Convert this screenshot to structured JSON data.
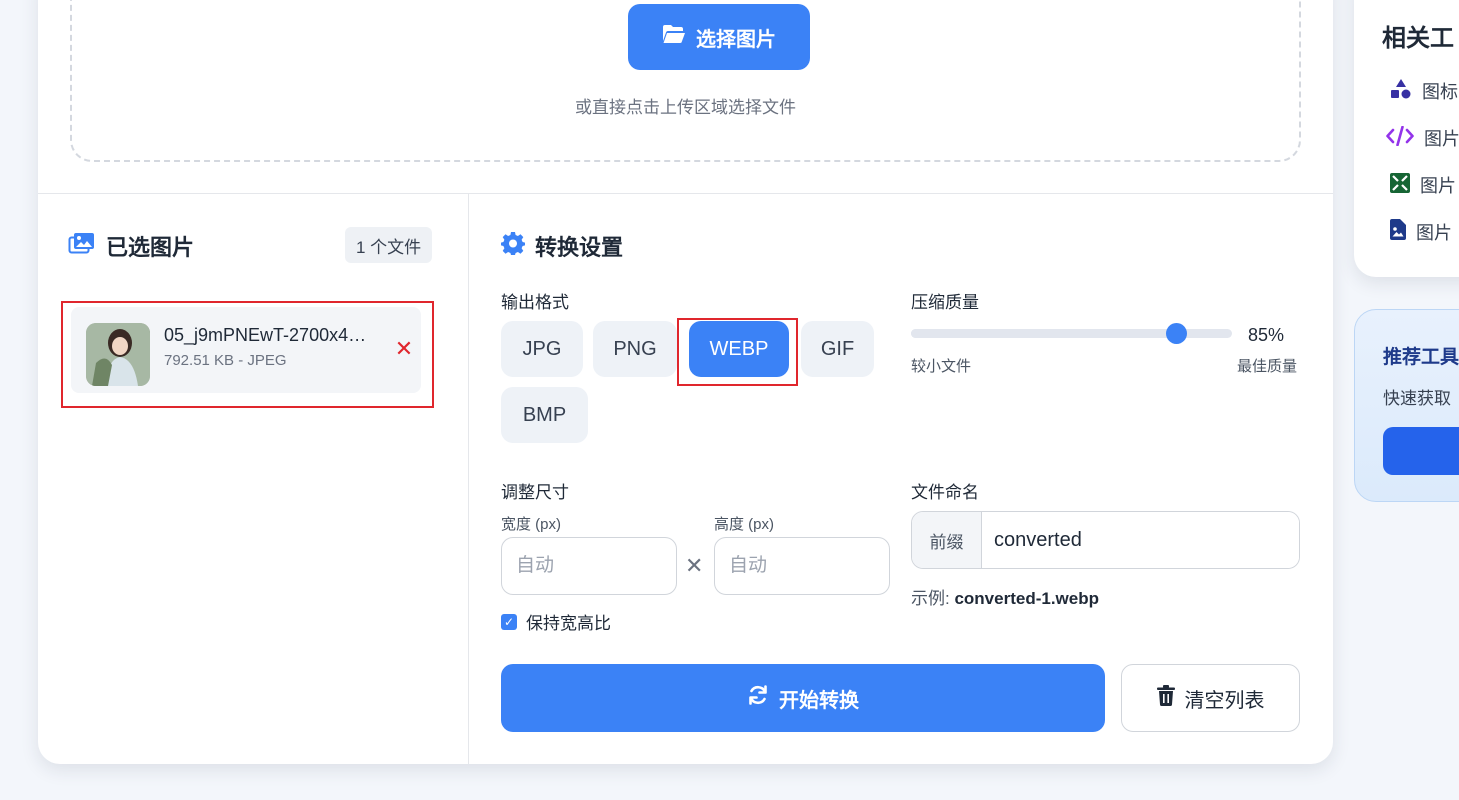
{
  "upload": {
    "select_button_label": "选择图片",
    "hint": "或直接点击上传区域选择文件"
  },
  "selected": {
    "title": "已选图片",
    "count_label": "1 个文件",
    "files": [
      {
        "name": "05_j9mPNEwT-2700x4…",
        "meta": "792.51 KB - JPEG"
      }
    ]
  },
  "settings": {
    "title": "转换设置",
    "output_format_label": "输出格式",
    "formats": [
      "JPG",
      "PNG",
      "WEBP",
      "GIF",
      "BMP"
    ],
    "selected_format": "WEBP",
    "quality_label": "压缩质量",
    "quality_value": 85,
    "quality_display": "85%",
    "quality_min_label": "较小文件",
    "quality_max_label": "最佳质量",
    "resize_label": "调整尺寸",
    "width_label": "宽度 (px)",
    "height_label": "高度 (px)",
    "width_placeholder": "自动",
    "height_placeholder": "自动",
    "times_symbol": "✕",
    "keep_ratio_label": "保持宽高比",
    "keep_ratio_checked": true,
    "naming_label": "文件命名",
    "prefix_label": "前缀",
    "prefix_value": "converted",
    "example_prefix": "示例: ",
    "example_value": "converted-1.webp"
  },
  "actions": {
    "convert_label": "开始转换",
    "clear_label": "清空列表"
  },
  "sidebar": {
    "related_title": "相关工",
    "links": [
      "图标",
      "图片",
      "图片",
      "图片"
    ],
    "recommend_title": "推荐工具",
    "recommend_desc": "快速获取"
  },
  "colors": {
    "accent": "#3b82f6",
    "danger": "#e0262d",
    "highlight_border": "#e0262d"
  }
}
